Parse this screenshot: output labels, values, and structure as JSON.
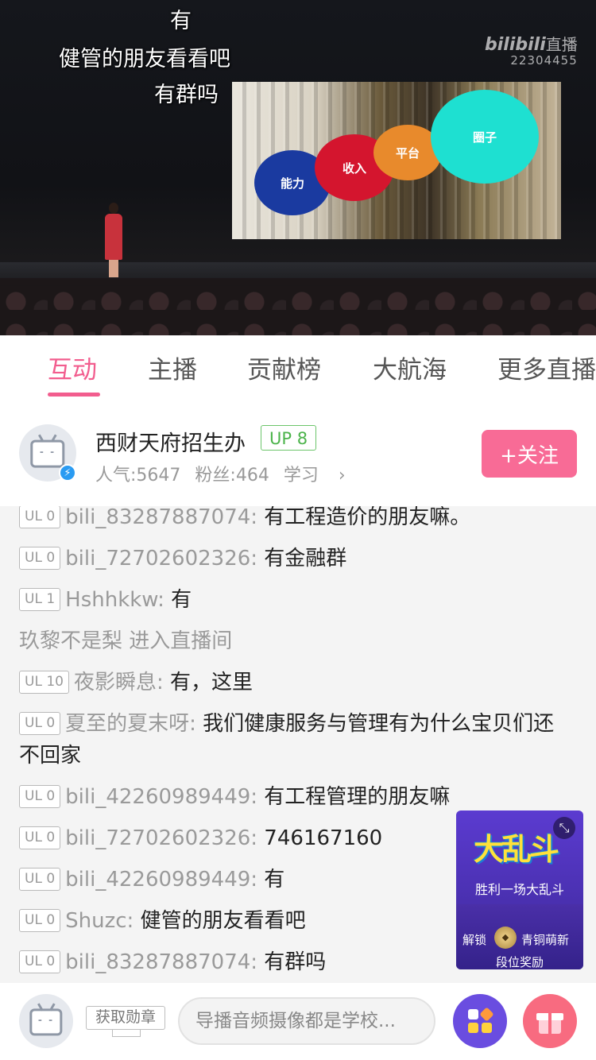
{
  "video": {
    "danmaku": [
      "有",
      "健管的朋友看看吧",
      "有群吗"
    ],
    "slide_bubbles": [
      "能力",
      "收入",
      "平台",
      "圈子"
    ],
    "watermark": {
      "brand": "bilibili",
      "live": "直播",
      "room_id": "22304455"
    }
  },
  "tabs": [
    {
      "label": "互动",
      "active": true
    },
    {
      "label": "主播"
    },
    {
      "label": "贡献榜"
    },
    {
      "label": "大航海"
    },
    {
      "label": "更多直播"
    }
  ],
  "anchor": {
    "name": "西财天府招生办",
    "up_level": "UP 8",
    "popularity": "人气:5647",
    "fans": "粉丝:464",
    "category": "学习",
    "follow_label": "+关注"
  },
  "chat": [
    {
      "level": "UL 0",
      "user": "bili_83287887074:",
      "text": " 有工程造价的朋友嘛。"
    },
    {
      "level": "UL 0",
      "user": "bili_72702602326:",
      "text": " 有金融群"
    },
    {
      "level": "UL 1",
      "user": "Hshhkkw:",
      "text": " 有"
    },
    {
      "system": "玖黎不是梨 进入直播间"
    },
    {
      "level": "UL 10",
      "user": "夜影瞬息:",
      "text": " 有，这里"
    },
    {
      "level": "UL 0",
      "user": "夏至的夏末呀:",
      "text": " 我们健康服务与管理有为什么宝贝们还不回家"
    },
    {
      "level": "UL 0",
      "user": "bili_42260989449:",
      "text": " 有工程管理的朋友嘛"
    },
    {
      "level": "UL 0",
      "user": "bili_72702602326:",
      "text": " 746167160"
    },
    {
      "level": "UL 0",
      "user": "bili_42260989449:",
      "text": " 有"
    },
    {
      "level": "UL 0",
      "user": "Shuzc:",
      "text": " 健管的朋友看看吧"
    },
    {
      "level": "UL 0",
      "user": "bili_83287887074:",
      "text": " 有群吗"
    }
  ],
  "promo": {
    "logo": "大乱斗",
    "slogan": "胜利一场大乱斗",
    "unlock": "解锁",
    "rank": "青铜萌新",
    "reward": "段位奖励"
  },
  "bottom": {
    "medal_label": "获取勋章",
    "input_placeholder": "导播音频摄像都是学校..."
  },
  "colors": {
    "accent": "#f25d8e",
    "follow": "#f86b96",
    "up_badge": "#4bb34a"
  }
}
